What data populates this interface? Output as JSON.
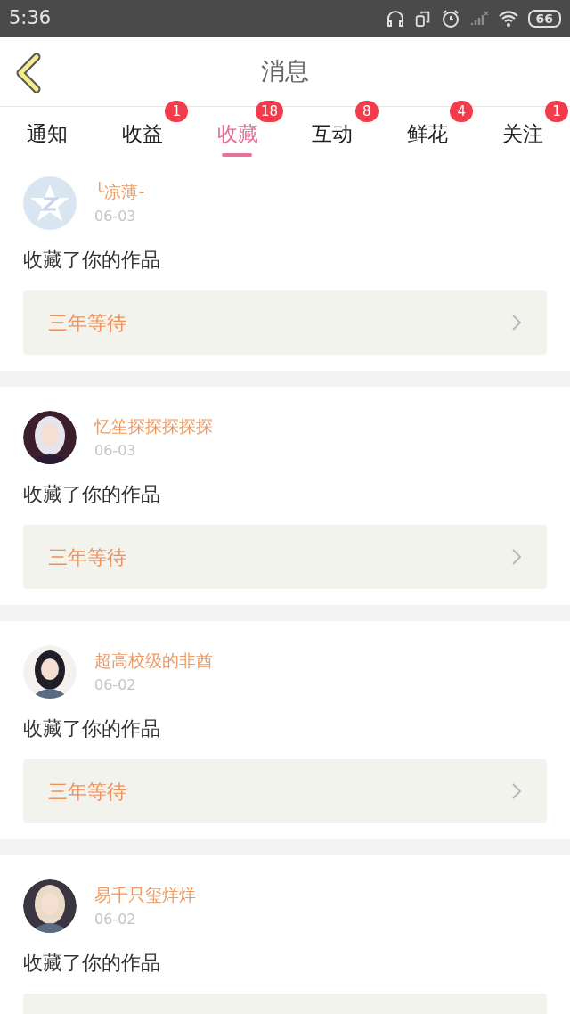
{
  "status_bar": {
    "time": "5:36",
    "battery": "66"
  },
  "header": {
    "title": "消息"
  },
  "tabs": [
    {
      "label": "通知",
      "selected": false
    },
    {
      "label": "收益",
      "selected": false,
      "badge": "1"
    },
    {
      "label": "收藏",
      "selected": true,
      "badge": "18"
    },
    {
      "label": "互动",
      "selected": false,
      "badge": "8"
    },
    {
      "label": "鲜花",
      "selected": false,
      "badge": "4"
    },
    {
      "label": "关注",
      "selected": false,
      "badge": "1"
    }
  ],
  "messages": [
    {
      "avatar": {
        "kind": "default"
      },
      "name": "╰凉薄-",
      "date": "06-03",
      "text": "收藏了你的作品",
      "work": "三年等待"
    },
    {
      "name": "忆笙探探探探探",
      "date": "06-03",
      "text": "收藏了你的作品",
      "work": "三年等待"
    },
    {
      "name": "超高校级的非酋",
      "date": "06-02",
      "text": "收藏了你的作品",
      "work": "三年等待"
    },
    {
      "name": "易千只玺烊烊",
      "date": "06-02",
      "text": "收藏了你的作品"
    }
  ]
}
